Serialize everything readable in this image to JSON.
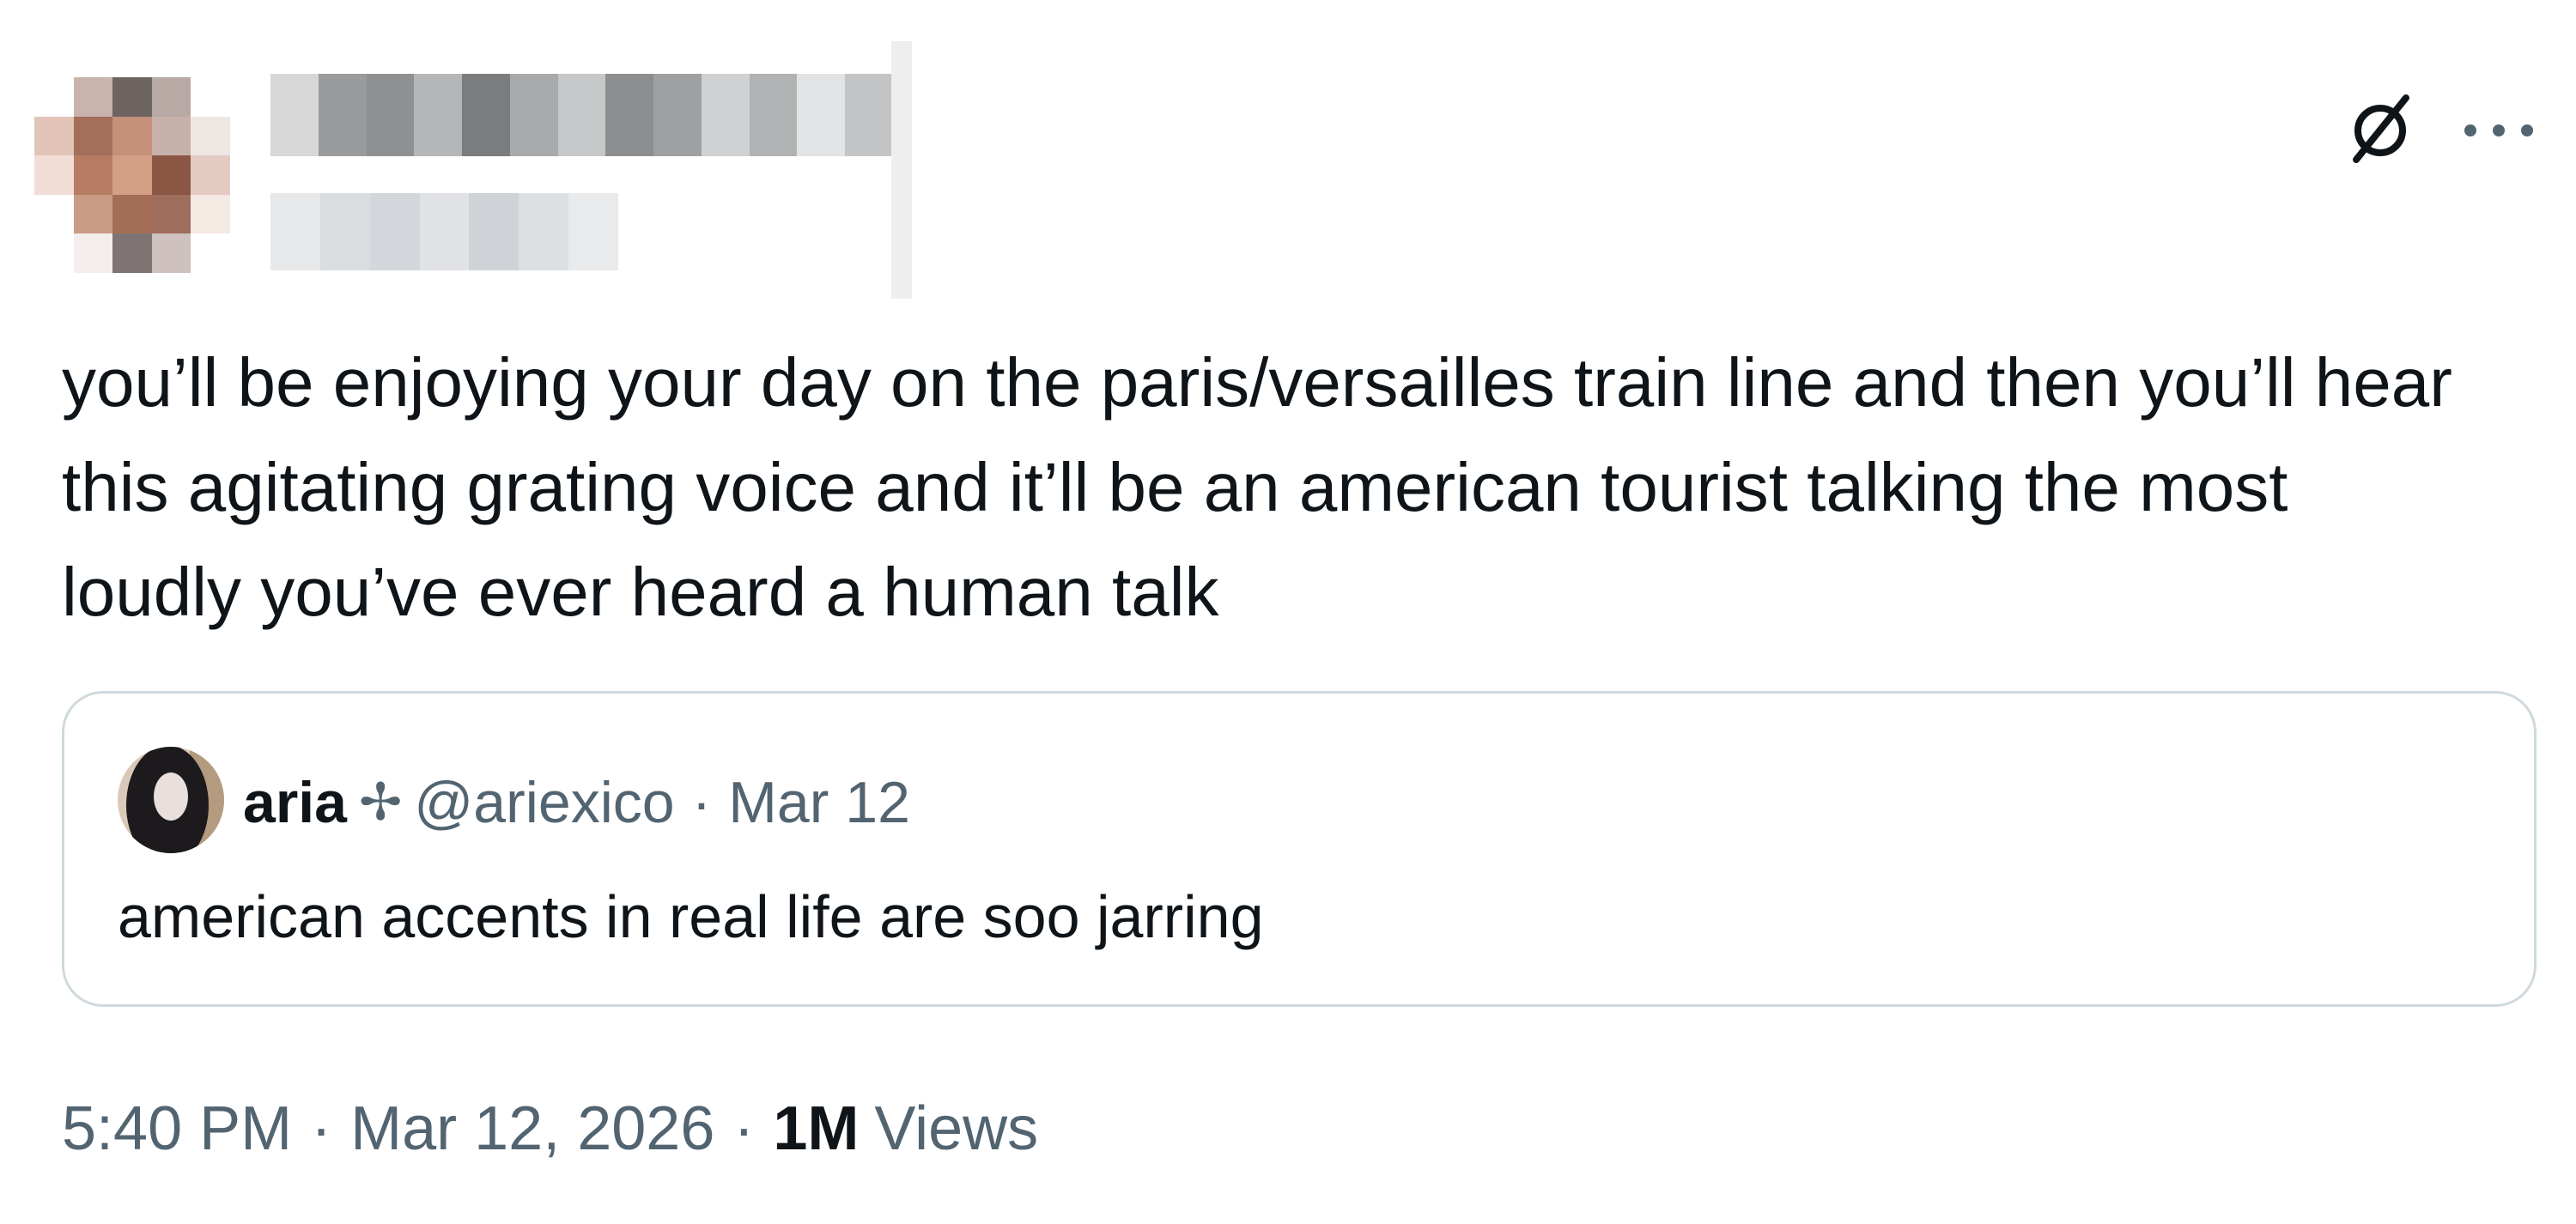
{
  "tweet": {
    "text": "you’ll be enjoying your day on the paris/versailles train line and then you’ll hear this agitating grating voice and it’ll be an american tourist talking the most loudly you’ve ever heard a human talk",
    "time": "5:40 PM",
    "date": "Mar 12, 2026",
    "separator": "·",
    "views_count": "1M",
    "views_label": "Views"
  },
  "quoted": {
    "name": "aria",
    "glyph": "✢",
    "handle": "@ariexico",
    "separator": "·",
    "date": "Mar 12",
    "text": "american accents in real life are soo jarring"
  },
  "icons": {
    "grok": "grok-icon",
    "more": "more-icon"
  },
  "colors": {
    "text": "#0f1419",
    "secondary": "#536471",
    "border": "#cfd9de"
  }
}
